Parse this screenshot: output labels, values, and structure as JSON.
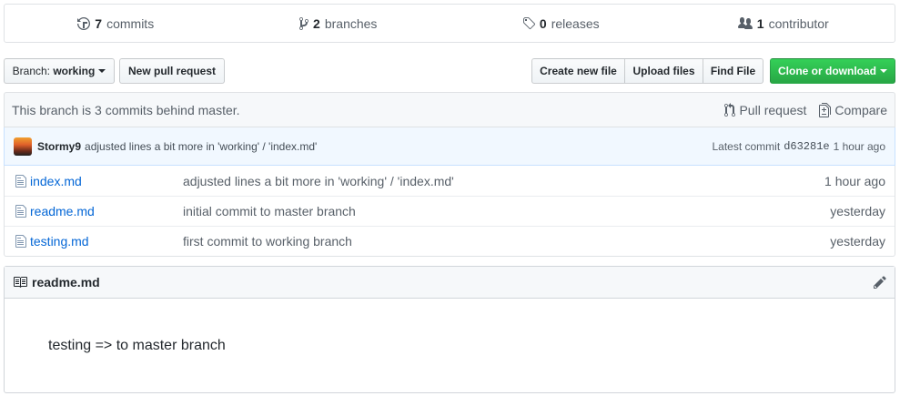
{
  "summary": {
    "commits_count": "7",
    "commits_label": "commits",
    "branches_count": "2",
    "branches_label": "branches",
    "releases_count": "0",
    "releases_label": "releases",
    "contributors_count": "1",
    "contributors_label": "contributor"
  },
  "toolbar": {
    "branch_prefix": "Branch:",
    "branch_name": "working",
    "new_pr": "New pull request",
    "create_file": "Create new file",
    "upload_files": "Upload files",
    "find_file": "Find File",
    "clone": "Clone or download"
  },
  "branch_info": {
    "status": "This branch is 3 commits behind master.",
    "pull_request": "Pull request",
    "compare": "Compare"
  },
  "latest_commit": {
    "author": "Stormy9",
    "message": "adjusted lines a bit more in 'working' / 'index.md'",
    "label": "Latest commit",
    "sha": "d63281e",
    "age": "1 hour ago"
  },
  "files": [
    {
      "name": "index.md",
      "message": "adjusted lines a bit more in 'working' / 'index.md'",
      "age": "1 hour ago"
    },
    {
      "name": "readme.md",
      "message": "initial commit to master branch",
      "age": "yesterday"
    },
    {
      "name": "testing.md",
      "message": "first commit to working branch",
      "age": "yesterday"
    }
  ],
  "readme": {
    "title": "readme.md",
    "content": "testing => to master branch"
  },
  "colors": {
    "link": "#0366d6",
    "green_button": "#28a745",
    "commit_tease_bg": "#f1f8ff"
  }
}
